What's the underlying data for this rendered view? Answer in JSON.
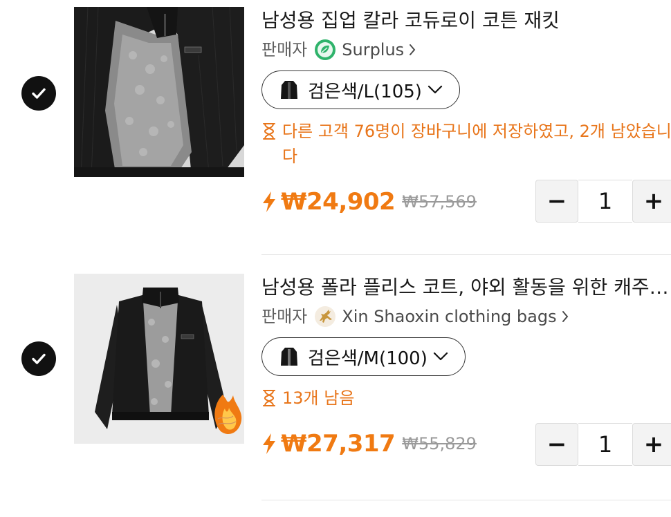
{
  "colors": {
    "accent_orange": "#f07a12",
    "notice_orange": "#e8751a",
    "check_bg": "#111111"
  },
  "items": [
    {
      "selected": true,
      "image_alt": "black corduroy zip-up jacket with fleece lining",
      "title": "남성용 집업 칼라 코듀로이 코튼 재킷",
      "seller_label": "판매자",
      "seller_name": "Surplus",
      "seller_logo_icon": "leaf-globe-icon",
      "variant": "검은색/L(105)",
      "notice": "다른 고객 76명이 장바구니에 저장하였고, 2개 남았습니다",
      "price": "₩24,902",
      "original_price": "₩57,569",
      "quantity": "1",
      "minus_label": "−",
      "plus_label": "+"
    },
    {
      "selected": true,
      "image_alt": "black polar fleece-lined coat",
      "title": "남성용 폴라 플리스 코트, 야외 활동을 위한 캐주얼 재킷",
      "seller_label": "판매자",
      "seller_name": "Xin Shaoxin clothing bags",
      "seller_logo_icon": "running-deer-icon",
      "variant": "검은색/M(100)",
      "notice": "13개 남음",
      "price": "₩27,317",
      "original_price": "₩55,829",
      "quantity": "1",
      "minus_label": "−",
      "plus_label": "+"
    }
  ]
}
